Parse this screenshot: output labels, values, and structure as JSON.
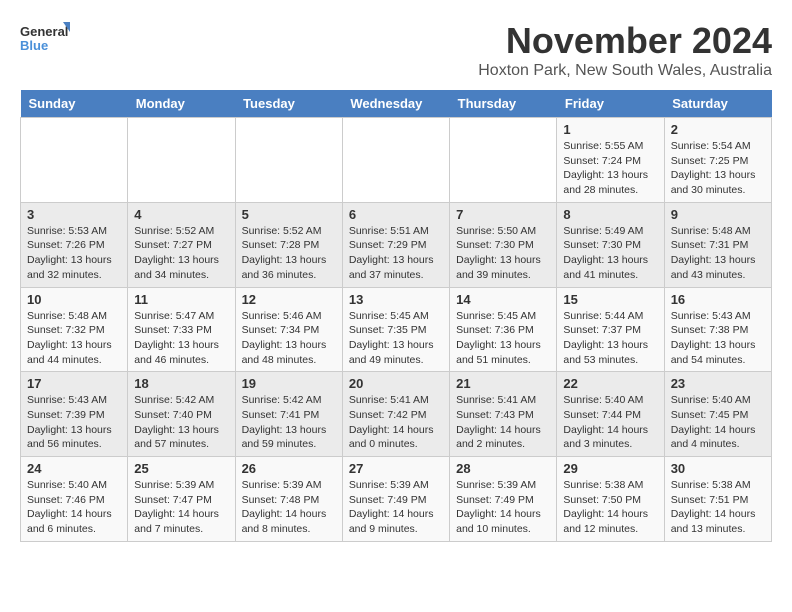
{
  "logo": {
    "line1": "General",
    "line2": "Blue"
  },
  "title": "November 2024",
  "location": "Hoxton Park, New South Wales, Australia",
  "days_of_week": [
    "Sunday",
    "Monday",
    "Tuesday",
    "Wednesday",
    "Thursday",
    "Friday",
    "Saturday"
  ],
  "weeks": [
    [
      {
        "day": "",
        "detail": ""
      },
      {
        "day": "",
        "detail": ""
      },
      {
        "day": "",
        "detail": ""
      },
      {
        "day": "",
        "detail": ""
      },
      {
        "day": "",
        "detail": ""
      },
      {
        "day": "1",
        "detail": "Sunrise: 5:55 AM\nSunset: 7:24 PM\nDaylight: 13 hours and 28 minutes."
      },
      {
        "day": "2",
        "detail": "Sunrise: 5:54 AM\nSunset: 7:25 PM\nDaylight: 13 hours and 30 minutes."
      }
    ],
    [
      {
        "day": "3",
        "detail": "Sunrise: 5:53 AM\nSunset: 7:26 PM\nDaylight: 13 hours and 32 minutes."
      },
      {
        "day": "4",
        "detail": "Sunrise: 5:52 AM\nSunset: 7:27 PM\nDaylight: 13 hours and 34 minutes."
      },
      {
        "day": "5",
        "detail": "Sunrise: 5:52 AM\nSunset: 7:28 PM\nDaylight: 13 hours and 36 minutes."
      },
      {
        "day": "6",
        "detail": "Sunrise: 5:51 AM\nSunset: 7:29 PM\nDaylight: 13 hours and 37 minutes."
      },
      {
        "day": "7",
        "detail": "Sunrise: 5:50 AM\nSunset: 7:30 PM\nDaylight: 13 hours and 39 minutes."
      },
      {
        "day": "8",
        "detail": "Sunrise: 5:49 AM\nSunset: 7:30 PM\nDaylight: 13 hours and 41 minutes."
      },
      {
        "day": "9",
        "detail": "Sunrise: 5:48 AM\nSunset: 7:31 PM\nDaylight: 13 hours and 43 minutes."
      }
    ],
    [
      {
        "day": "10",
        "detail": "Sunrise: 5:48 AM\nSunset: 7:32 PM\nDaylight: 13 hours and 44 minutes."
      },
      {
        "day": "11",
        "detail": "Sunrise: 5:47 AM\nSunset: 7:33 PM\nDaylight: 13 hours and 46 minutes."
      },
      {
        "day": "12",
        "detail": "Sunrise: 5:46 AM\nSunset: 7:34 PM\nDaylight: 13 hours and 48 minutes."
      },
      {
        "day": "13",
        "detail": "Sunrise: 5:45 AM\nSunset: 7:35 PM\nDaylight: 13 hours and 49 minutes."
      },
      {
        "day": "14",
        "detail": "Sunrise: 5:45 AM\nSunset: 7:36 PM\nDaylight: 13 hours and 51 minutes."
      },
      {
        "day": "15",
        "detail": "Sunrise: 5:44 AM\nSunset: 7:37 PM\nDaylight: 13 hours and 53 minutes."
      },
      {
        "day": "16",
        "detail": "Sunrise: 5:43 AM\nSunset: 7:38 PM\nDaylight: 13 hours and 54 minutes."
      }
    ],
    [
      {
        "day": "17",
        "detail": "Sunrise: 5:43 AM\nSunset: 7:39 PM\nDaylight: 13 hours and 56 minutes."
      },
      {
        "day": "18",
        "detail": "Sunrise: 5:42 AM\nSunset: 7:40 PM\nDaylight: 13 hours and 57 minutes."
      },
      {
        "day": "19",
        "detail": "Sunrise: 5:42 AM\nSunset: 7:41 PM\nDaylight: 13 hours and 59 minutes."
      },
      {
        "day": "20",
        "detail": "Sunrise: 5:41 AM\nSunset: 7:42 PM\nDaylight: 14 hours and 0 minutes."
      },
      {
        "day": "21",
        "detail": "Sunrise: 5:41 AM\nSunset: 7:43 PM\nDaylight: 14 hours and 2 minutes."
      },
      {
        "day": "22",
        "detail": "Sunrise: 5:40 AM\nSunset: 7:44 PM\nDaylight: 14 hours and 3 minutes."
      },
      {
        "day": "23",
        "detail": "Sunrise: 5:40 AM\nSunset: 7:45 PM\nDaylight: 14 hours and 4 minutes."
      }
    ],
    [
      {
        "day": "24",
        "detail": "Sunrise: 5:40 AM\nSunset: 7:46 PM\nDaylight: 14 hours and 6 minutes."
      },
      {
        "day": "25",
        "detail": "Sunrise: 5:39 AM\nSunset: 7:47 PM\nDaylight: 14 hours and 7 minutes."
      },
      {
        "day": "26",
        "detail": "Sunrise: 5:39 AM\nSunset: 7:48 PM\nDaylight: 14 hours and 8 minutes."
      },
      {
        "day": "27",
        "detail": "Sunrise: 5:39 AM\nSunset: 7:49 PM\nDaylight: 14 hours and 9 minutes."
      },
      {
        "day": "28",
        "detail": "Sunrise: 5:39 AM\nSunset: 7:49 PM\nDaylight: 14 hours and 10 minutes."
      },
      {
        "day": "29",
        "detail": "Sunrise: 5:38 AM\nSunset: 7:50 PM\nDaylight: 14 hours and 12 minutes."
      },
      {
        "day": "30",
        "detail": "Sunrise: 5:38 AM\nSunset: 7:51 PM\nDaylight: 14 hours and 13 minutes."
      }
    ]
  ]
}
